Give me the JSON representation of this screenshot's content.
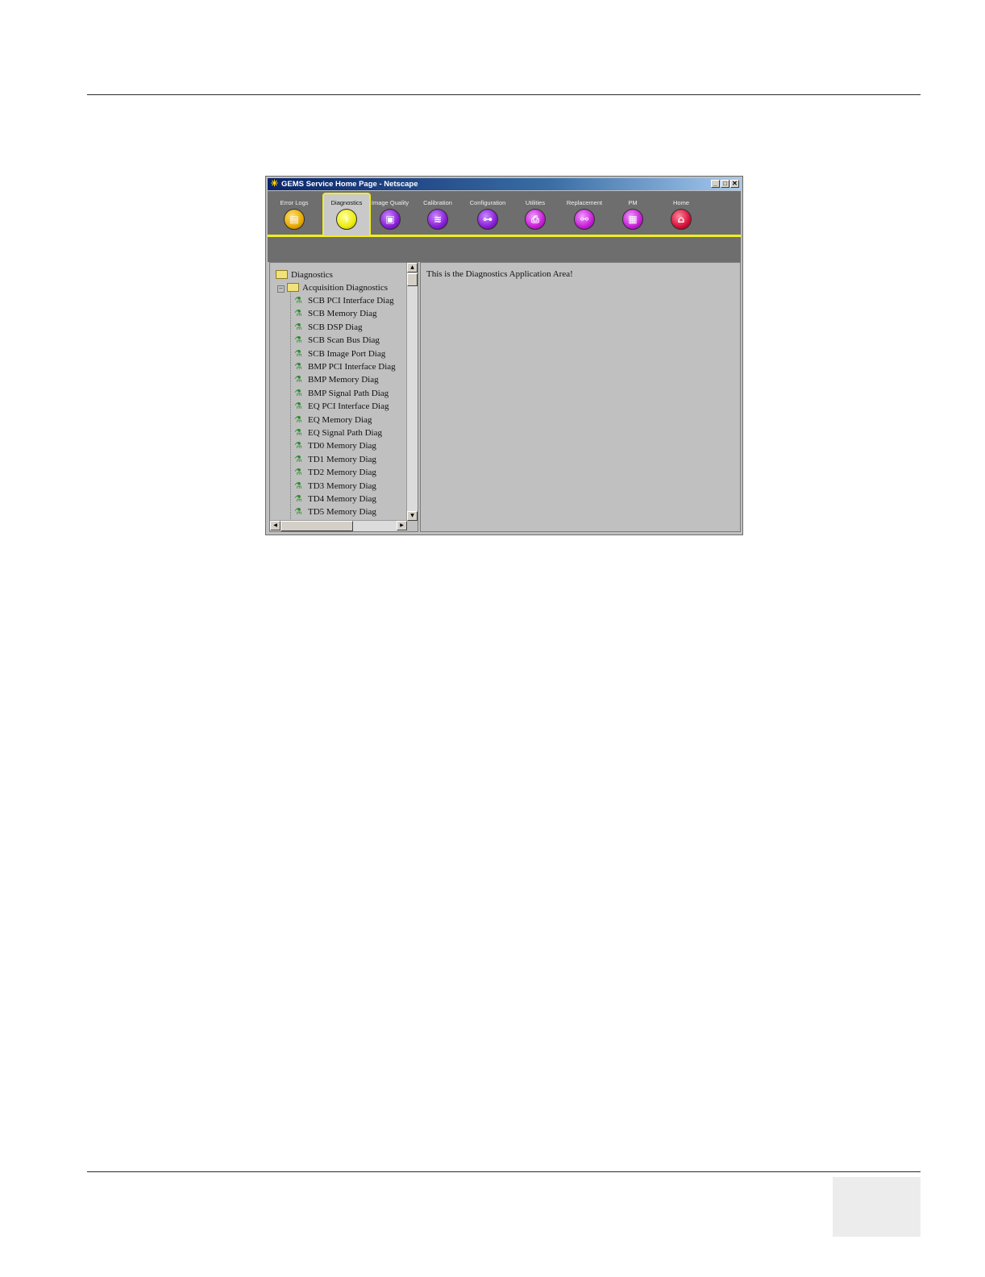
{
  "window": {
    "title": "GEMS Service Home Page - Netscape",
    "controls": [
      "_",
      "□",
      "✕"
    ]
  },
  "toolbar": {
    "tabs": [
      {
        "label": "Error Logs",
        "icon": "error-logs-icon",
        "color": "#e8a800",
        "active": false
      },
      {
        "label": "Diagnostics",
        "icon": "diagnostics-icon",
        "color": "#ecec10",
        "active": true
      },
      {
        "label": "Image Quality",
        "icon": "image-quality-icon",
        "color": "#8a1ed8",
        "active": false
      },
      {
        "label": "Calibration",
        "icon": "calibration-icon",
        "color": "#8a1ed8",
        "active": false
      },
      {
        "label": "Configuration",
        "icon": "configuration-icon",
        "color": "#8a1ed8",
        "active": false
      },
      {
        "label": "Utilities",
        "icon": "utilities-icon",
        "color": "#c81ed8",
        "active": false
      },
      {
        "label": "Replacement",
        "icon": "replacement-icon",
        "color": "#c81ed8",
        "active": false
      },
      {
        "label": "PM",
        "icon": "pm-icon",
        "color": "#c81ed8",
        "active": false
      },
      {
        "label": "Home",
        "icon": "home-icon",
        "color": "#d8103a",
        "active": false
      }
    ]
  },
  "tree": {
    "root": "Diagnostics",
    "group": "Acquisition Diagnostics",
    "items": [
      "SCB PCI Interface Diag",
      "SCB Memory Diag",
      "SCB DSP Diag",
      "SCB Scan Bus Diag",
      "SCB Image Port Diag",
      "BMP PCI Interface Diag",
      "BMP Memory Diag",
      "BMP Signal Path Diag",
      "EQ PCI Interface Diag",
      "EQ Memory Diag",
      "EQ Signal Path Diag",
      "TD0 Memory Diag",
      "TD1 Memory Diag",
      "TD2 Memory Diag",
      "TD3 Memory Diag",
      "TD4 Memory Diag",
      "TD5 Memory Diag"
    ]
  },
  "content": {
    "message": "This is the Diagnostics Application Area!"
  }
}
